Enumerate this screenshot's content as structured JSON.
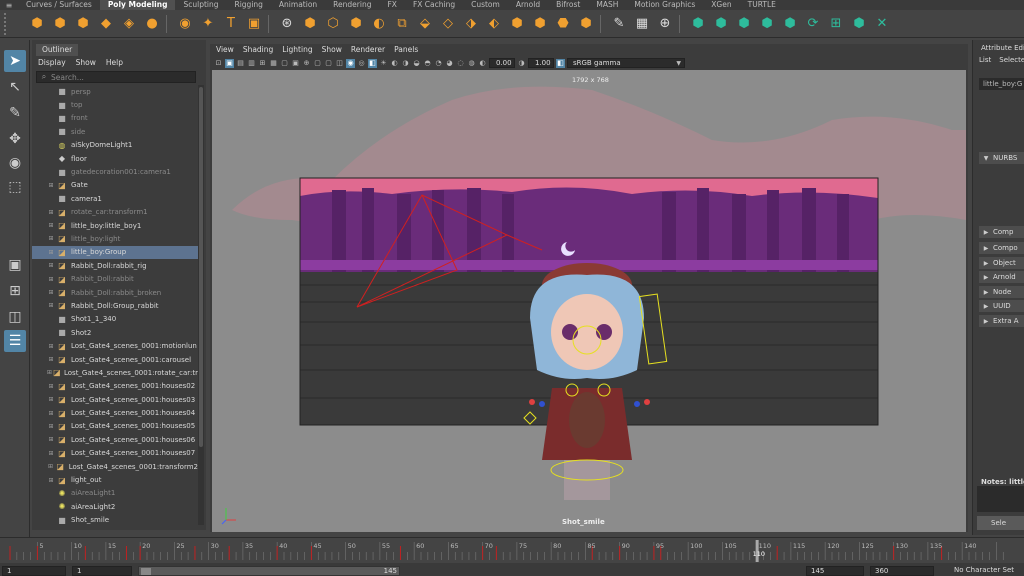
{
  "shelf_tabs": [
    "Curves / Surfaces",
    "Poly Modeling",
    "Sculpting",
    "Rigging",
    "Animation",
    "Rendering",
    "FX",
    "FX Caching",
    "Custom",
    "Arnold",
    "Bifrost",
    "MASH",
    "Motion Graphics",
    "XGen",
    "TURTLE"
  ],
  "shelf_active_tab": "Poly Modeling",
  "shelf_icons": [
    {
      "name": "poly-sphere-icon",
      "glyph": "⬢",
      "color": "orange"
    },
    {
      "name": "poly-cube-icon",
      "glyph": "⬢",
      "color": "orange"
    },
    {
      "name": "poly-cylinder-icon",
      "glyph": "⬢",
      "color": "orange"
    },
    {
      "name": "poly-cone-icon",
      "glyph": "◆",
      "color": "orange"
    },
    {
      "name": "poly-plane-icon",
      "glyph": "◈",
      "color": "orange"
    },
    {
      "name": "poly-torus-icon",
      "glyph": "●",
      "color": "orange"
    },
    {
      "name": "separator",
      "glyph": "",
      "color": "sep"
    },
    {
      "name": "poly-disc-icon",
      "glyph": "◉",
      "color": "orange"
    },
    {
      "name": "poly-platonic-icon",
      "glyph": "✦",
      "color": "orange"
    },
    {
      "name": "poly-text-icon",
      "glyph": "T",
      "color": "orange"
    },
    {
      "name": "poly-svg-icon",
      "glyph": "▣",
      "color": "orange"
    },
    {
      "name": "separator",
      "glyph": "",
      "color": "sep"
    },
    {
      "name": "sculpt-icon",
      "glyph": "⊛",
      "color": "white"
    },
    {
      "name": "combine-icon",
      "glyph": "⬢",
      "color": "orange"
    },
    {
      "name": "separate-icon",
      "glyph": "⬡",
      "color": "orange"
    },
    {
      "name": "smooth-icon",
      "glyph": "⬢",
      "color": "orange"
    },
    {
      "name": "bool-icon",
      "glyph": "◐",
      "color": "orange"
    },
    {
      "name": "mirror-icon",
      "glyph": "⧉",
      "color": "orange"
    },
    {
      "name": "extract-icon",
      "glyph": "⬙",
      "color": "orange"
    },
    {
      "name": "reduce-icon",
      "glyph": "◇",
      "color": "orange"
    },
    {
      "name": "fill-hole-icon",
      "glyph": "⬗",
      "color": "orange"
    },
    {
      "name": "bridge-icon",
      "glyph": "⬖",
      "color": "orange"
    },
    {
      "name": "bevel-icon",
      "glyph": "⬢",
      "color": "orange"
    },
    {
      "name": "extrude-icon",
      "glyph": "⬢",
      "color": "orange"
    },
    {
      "name": "append-icon",
      "glyph": "⬣",
      "color": "orange"
    },
    {
      "name": "merge-icon",
      "glyph": "⬢",
      "color": "orange"
    },
    {
      "name": "separator",
      "glyph": "",
      "color": "sep"
    },
    {
      "name": "multi-cut-icon",
      "glyph": "✎",
      "color": "white"
    },
    {
      "name": "insert-edge-loop-icon",
      "glyph": "▦",
      "color": "white"
    },
    {
      "name": "target-weld-icon",
      "glyph": "⊕",
      "color": "white"
    },
    {
      "name": "separator",
      "glyph": "",
      "color": "sep"
    },
    {
      "name": "uv-planar-icon",
      "glyph": "⬢",
      "color": "teal"
    },
    {
      "name": "uv-cylindrical-icon",
      "glyph": "⬢",
      "color": "teal"
    },
    {
      "name": "uv-spherical-icon",
      "glyph": "⬢",
      "color": "teal"
    },
    {
      "name": "uv-automatic-icon",
      "glyph": "⬢",
      "color": "teal"
    },
    {
      "name": "uv-camera-icon",
      "glyph": "⬢",
      "color": "teal"
    },
    {
      "name": "uv-rotate-icon",
      "glyph": "⟳",
      "color": "teal"
    },
    {
      "name": "uv-layout-icon",
      "glyph": "⊞",
      "color": "teal"
    },
    {
      "name": "uv-editor-icon",
      "glyph": "⬢",
      "color": "teal"
    },
    {
      "name": "uv-toolkit-icon",
      "glyph": "✕",
      "color": "teal"
    }
  ],
  "outliner": {
    "tab": "Outliner",
    "menu": [
      "Display",
      "Show",
      "Help"
    ],
    "search_placeholder": "Search...",
    "items": [
      {
        "label": "persp",
        "icon": "cam",
        "expand": false,
        "dim": true
      },
      {
        "label": "top",
        "icon": "cam",
        "expand": false,
        "dim": true
      },
      {
        "label": "front",
        "icon": "cam",
        "expand": false,
        "dim": true
      },
      {
        "label": "side",
        "icon": "cam",
        "expand": false,
        "dim": true
      },
      {
        "label": "aiSkyDomeLight1",
        "icon": "globe",
        "expand": false,
        "dim": false
      },
      {
        "label": "floor",
        "icon": "floor",
        "expand": false,
        "dim": false
      },
      {
        "label": "gatedecoration001:camera1",
        "icon": "cam",
        "expand": false,
        "dim": true
      },
      {
        "label": "Gate",
        "icon": "grp",
        "expand": true,
        "dim": false
      },
      {
        "label": "camera1",
        "icon": "cam",
        "expand": false,
        "dim": false
      },
      {
        "label": "rotate_car:transform1",
        "icon": "grp",
        "expand": true,
        "dim": true
      },
      {
        "label": "little_boy:little_boy1",
        "icon": "grp",
        "expand": true,
        "dim": false
      },
      {
        "label": "little_boy:light",
        "icon": "grp",
        "expand": true,
        "dim": true
      },
      {
        "label": "little_boy:Group",
        "icon": "grp",
        "expand": true,
        "dim": false,
        "selected": true
      },
      {
        "label": "Rabbit_Doll:rabbit_rig",
        "icon": "grp",
        "expand": true,
        "dim": false
      },
      {
        "label": "Rabbit_Doll:rabbit",
        "icon": "grp",
        "expand": true,
        "dim": true
      },
      {
        "label": "Rabbit_Doll:rabbit_broken",
        "icon": "grp",
        "expand": true,
        "dim": true
      },
      {
        "label": "Rabbit_Doll:Group_rabbit",
        "icon": "grp",
        "expand": true,
        "dim": false
      },
      {
        "label": "Shot1_1_340",
        "icon": "cam",
        "expand": false,
        "dim": false
      },
      {
        "label": "Shot2",
        "icon": "cam",
        "expand": false,
        "dim": false
      },
      {
        "label": "Lost_Gate4_scenes_0001:motionlun",
        "icon": "grp",
        "expand": true,
        "dim": false
      },
      {
        "label": "Lost_Gate4_scenes_0001:carousel",
        "icon": "grp",
        "expand": true,
        "dim": false
      },
      {
        "label": "Lost_Gate4_scenes_0001:rotate_car:tr",
        "icon": "grp",
        "expand": true,
        "dim": false
      },
      {
        "label": "Lost_Gate4_scenes_0001:houses02",
        "icon": "grp",
        "expand": true,
        "dim": false
      },
      {
        "label": "Lost_Gate4_scenes_0001:houses03",
        "icon": "grp",
        "expand": true,
        "dim": false
      },
      {
        "label": "Lost_Gate4_scenes_0001:houses04",
        "icon": "grp",
        "expand": true,
        "dim": false
      },
      {
        "label": "Lost_Gate4_scenes_0001:houses05",
        "icon": "grp",
        "expand": true,
        "dim": false
      },
      {
        "label": "Lost_Gate4_scenes_0001:houses06",
        "icon": "grp",
        "expand": true,
        "dim": false
      },
      {
        "label": "Lost_Gate4_scenes_0001:houses07",
        "icon": "grp",
        "expand": true,
        "dim": false
      },
      {
        "label": "Lost_Gate4_scenes_0001:transform2",
        "icon": "grp",
        "expand": true,
        "dim": false
      },
      {
        "label": "light_out",
        "icon": "grp",
        "expand": true,
        "dim": false
      },
      {
        "label": "aiAreaLight1",
        "icon": "light",
        "expand": false,
        "dim": true
      },
      {
        "label": "aiAreaLight2",
        "icon": "light",
        "expand": false,
        "dim": false
      },
      {
        "label": "Shot_smile",
        "icon": "cam",
        "expand": false,
        "dim": false
      }
    ]
  },
  "viewport": {
    "menu": [
      "View",
      "Shading",
      "Lighting",
      "Show",
      "Renderer",
      "Panels"
    ],
    "exposure": "0.00",
    "gamma": "1.00",
    "color_space": "sRGB gamma",
    "resolution": "1792 x 768",
    "camera": "Shot_smile"
  },
  "attribute_editor": {
    "title": "Attribute Edi",
    "menu": [
      "List",
      "Selecte"
    ],
    "node": "little_boy:G",
    "sections": [
      "NURBS",
      "Comp",
      "Compo",
      "Object",
      "Arnold",
      "Node",
      "UUID",
      "Extra A"
    ],
    "notes_label": "Notes:  little",
    "select_button": "Sele"
  },
  "timeline": {
    "ticks": [
      5,
      10,
      15,
      20,
      25,
      30,
      35,
      40,
      45,
      50,
      55,
      60,
      65,
      70,
      75,
      80,
      85,
      90,
      95,
      100,
      105,
      110,
      115,
      120,
      125,
      130,
      135,
      140
    ],
    "current_frame": "110",
    "keys": [
      1,
      5,
      12,
      18,
      20,
      28,
      33,
      40,
      45,
      58,
      70,
      72,
      86,
      90,
      95,
      96,
      110,
      113,
      130,
      137
    ]
  },
  "range": {
    "start": "1",
    "anim_start": "1",
    "slider_start": "1",
    "slider_end": "145",
    "end": "145",
    "anim_end": "360",
    "char_set": "No Character Set"
  }
}
